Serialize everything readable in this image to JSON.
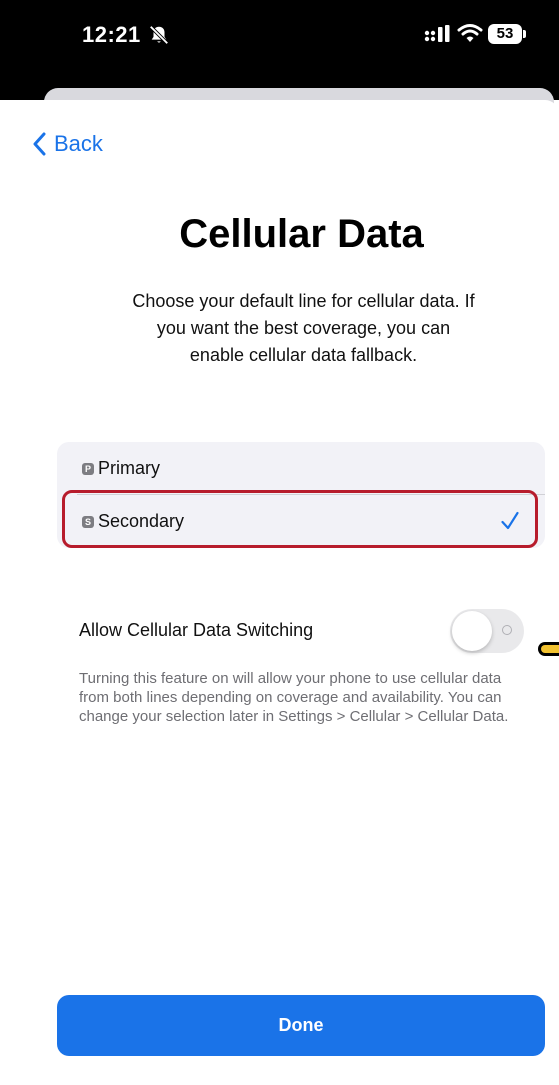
{
  "status_bar": {
    "time": "12:21",
    "battery_level": "53",
    "icons": [
      "bell-off-icon",
      "signal-icon",
      "wifi-icon",
      "battery-icon"
    ]
  },
  "nav": {
    "back_label": "Back"
  },
  "header": {
    "title": "Cellular Data",
    "subtitle": "Choose your default line for cellular data. If you want the best coverage, you can enable cellular data fallback."
  },
  "lines": [
    {
      "badge": "P",
      "label": "Primary",
      "selected": false
    },
    {
      "badge": "S",
      "label": "Secondary",
      "selected": true
    }
  ],
  "data_switching": {
    "label": "Allow Cellular Data Switching",
    "enabled": false,
    "description": "Turning this feature on will allow your phone to use cellular data from both lines depending on coverage and availability. You can change your selection later in Settings > Cellular > Cellular Data."
  },
  "footer": {
    "done_label": "Done"
  },
  "colors": {
    "accent": "#1a73e8",
    "highlight_border": "#b71c2c",
    "side_indicator": "#f2c230"
  }
}
